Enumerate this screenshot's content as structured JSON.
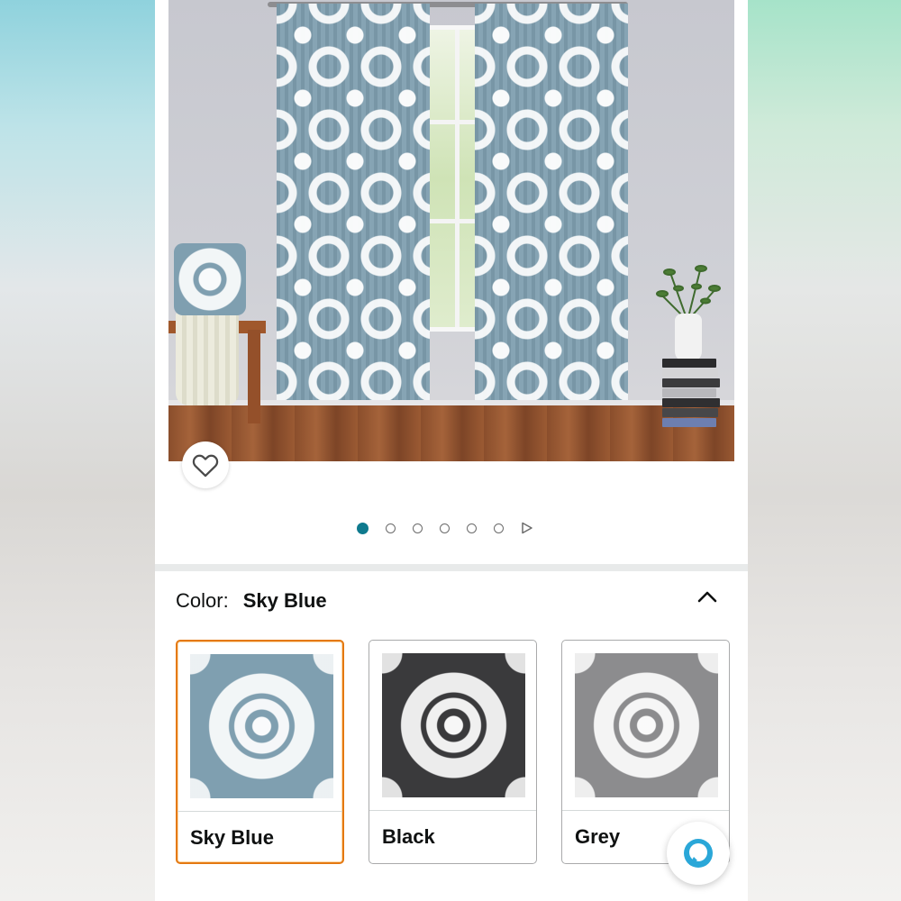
{
  "product": {
    "image_alt": "Sky Blue medallion sheer curtains",
    "carousel": {
      "total_dots": 6,
      "active_index": 0
    }
  },
  "color_selector": {
    "label": "Color:",
    "selected": "Sky Blue",
    "options": [
      {
        "name": "Sky Blue",
        "color": "#7f9fb0",
        "selected": true
      },
      {
        "name": "Black",
        "color": "#3a3a3c",
        "selected": false
      },
      {
        "name": "Grey",
        "color": "#8c8c8e",
        "selected": false
      }
    ]
  },
  "icons": {
    "favorite": "heart-icon",
    "collapse": "chevron-up-icon",
    "next": "play-icon",
    "assistant": "alexa-icon"
  },
  "colors": {
    "accent": "#0f7a8e",
    "selected_border": "#e47911",
    "text": "#0f1111"
  }
}
